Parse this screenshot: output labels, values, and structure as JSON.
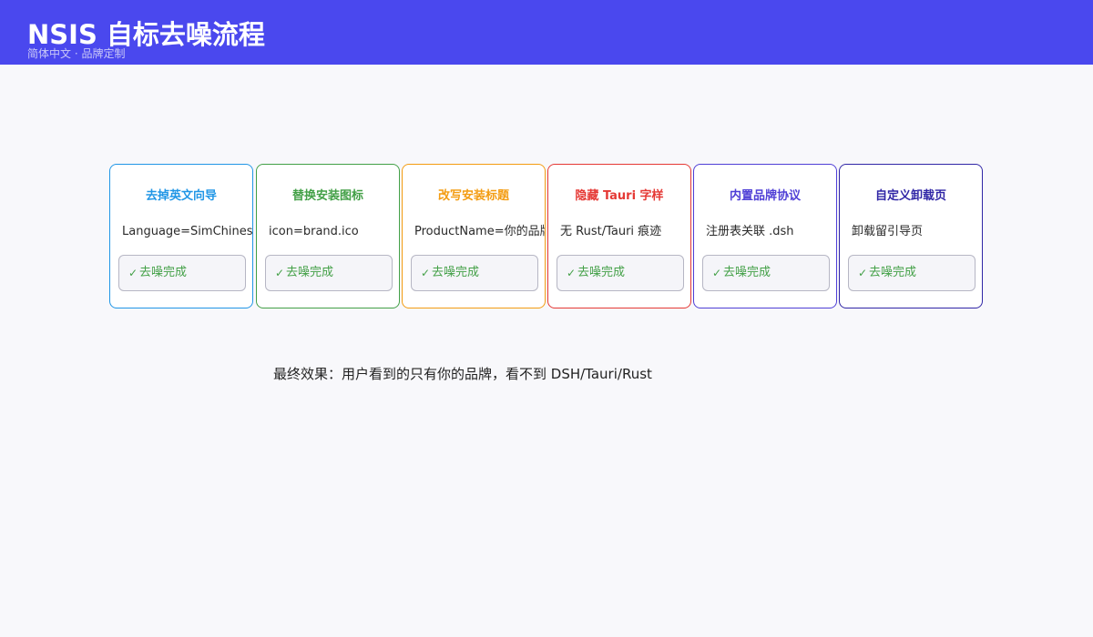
{
  "header": {
    "title": "NSIS 自标去噪流程",
    "subtitle": "简体中文 · 品牌定制",
    "background": "#4a48ee"
  },
  "steps": [
    {
      "title": "去掉英文向导",
      "config": "Language=SimChinese",
      "status": "去噪完成",
      "status_icon": "check-icon",
      "color": "#2196e6"
    },
    {
      "title": "替换安装图标",
      "config": "icon=brand.ico",
      "status": "去噪完成",
      "status_icon": "check-icon",
      "color": "#43a047"
    },
    {
      "title": "改写安装标题",
      "config": "ProductName=你的品牌",
      "status": "去噪完成",
      "status_icon": "check-icon",
      "color": "#f39c12"
    },
    {
      "title": "隐藏 Tauri 字样",
      "config": "无 Rust/Tauri 痕迹",
      "status": "去噪完成",
      "status_icon": "check-icon",
      "color": "#e53935"
    },
    {
      "title": "内置品牌协议",
      "config": "注册表关联 .dsh",
      "status": "去噪完成",
      "status_icon": "check-icon",
      "color": "#4f3fd6"
    },
    {
      "title": "自定义卸载页",
      "config": "卸载留引导页",
      "status": "去噪完成",
      "status_icon": "check-icon",
      "color": "#3026a6"
    }
  ],
  "summary": "最终效果：用户看到的只有你的品牌，看不到 DSH/Tauri/Rust"
}
